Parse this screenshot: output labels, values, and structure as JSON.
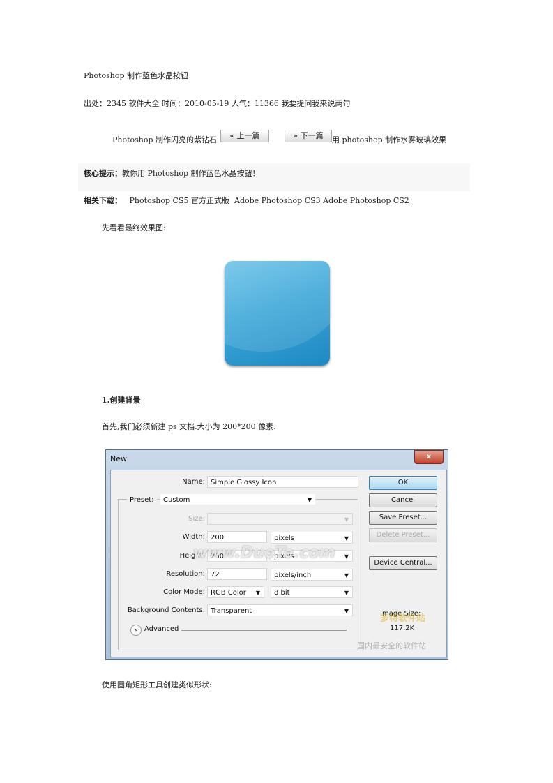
{
  "title": "Photoshop 制作蓝色水晶按钮",
  "meta": "出处：2345 软件大全  时间：2010-05-19  人气：11366 我要提问我来说两句",
  "nav": {
    "prev_article": "Photoshop 制作闪亮的紫钻石",
    "prev_button": "« 上一篇",
    "next_button": "» 下一篇",
    "next_article": "用 photoshop 制作水雾玻璃效果"
  },
  "hint": {
    "label": "核心提示：",
    "text": "教你用 Photoshop 制作蓝色水晶按钮！"
  },
  "downloads": {
    "label": "相关下载：",
    "items": [
      "Photoshop CS5 官方正式版",
      "Adobe Photoshop CS3",
      "Adobe Photoshop CS2"
    ]
  },
  "intro": "先看看最终效果图:",
  "step1": {
    "heading": "1.创建背景",
    "text": "首先,我们必须新建 ps 文档.大小为 200*200 像素."
  },
  "dialog": {
    "title": "New",
    "close": "x",
    "name_label": "Name:",
    "name_value": "Simple Glossy Icon",
    "preset_label": "Preset:",
    "preset_value": "Custom",
    "size_label": "Size:",
    "width_label": "Width:",
    "width_value": "200",
    "width_unit": "pixels",
    "height_label": "Height:",
    "height_value": "200",
    "height_unit": "pixels",
    "resolution_label": "Resolution:",
    "resolution_value": "72",
    "resolution_unit": "pixels/inch",
    "colormode_label": "Color Mode:",
    "colormode_value": "RGB Color",
    "bitdepth_value": "8 bit",
    "bg_label": "Background Contents:",
    "bg_value": "Transparent",
    "advanced": "Advanced",
    "buttons": {
      "ok": "OK",
      "cancel": "Cancel",
      "save": "Save Preset...",
      "delete": "Delete Preset...",
      "device": "Device Central..."
    },
    "image_size_label": "Image Size:",
    "image_size_value": "117.2K",
    "watermark": "www.DuoTe.com",
    "watermark2": "多特软件站",
    "watermark3": "国内最安全的软件站"
  },
  "step2_text": "使用圆角矩形工具创建类似形状:"
}
